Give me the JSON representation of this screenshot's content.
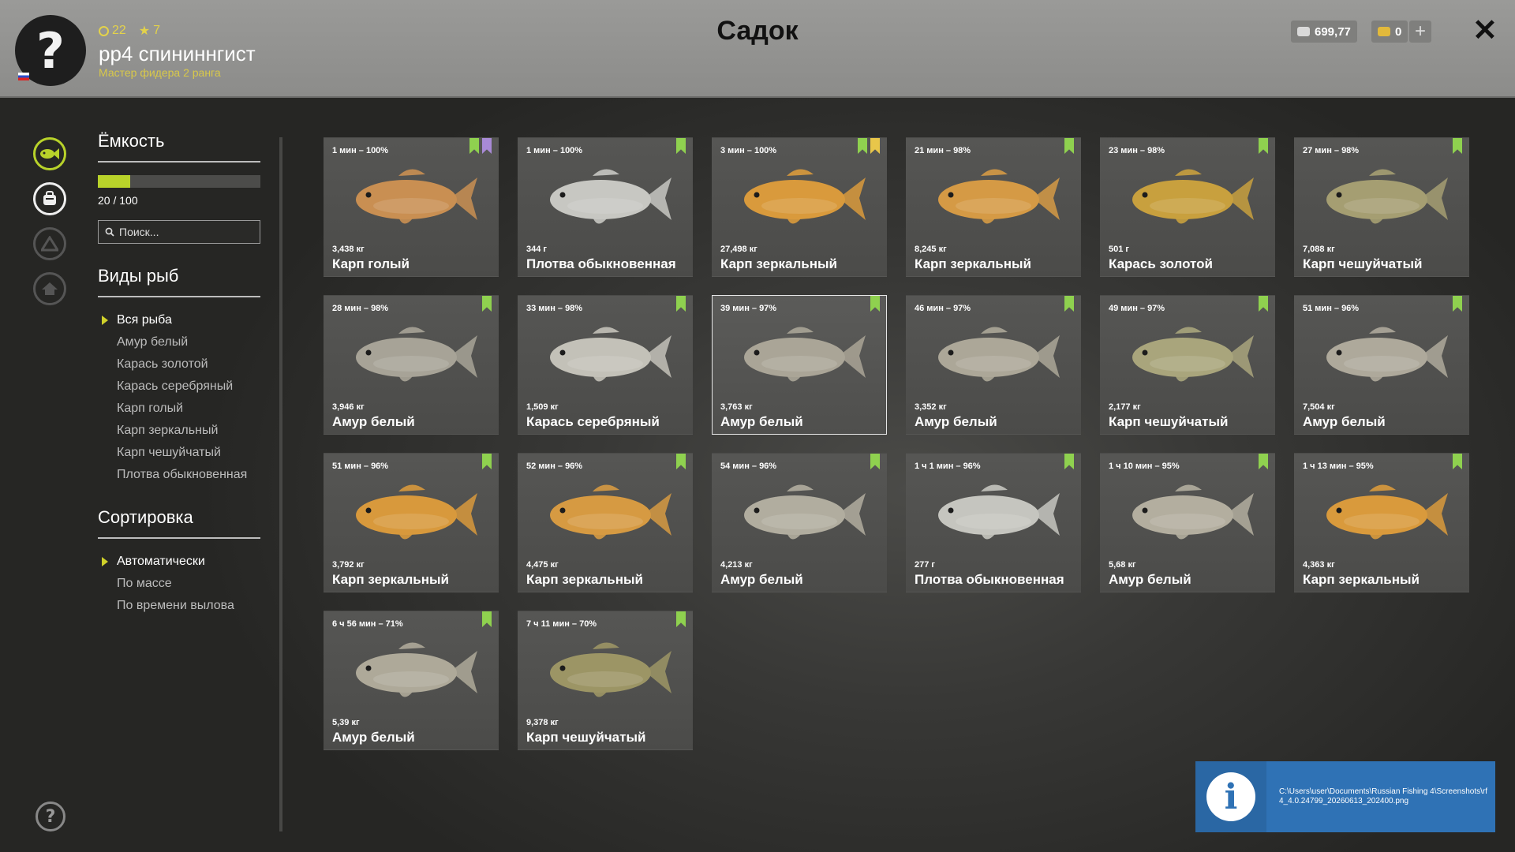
{
  "header": {
    "title": "Садок",
    "player": {
      "avatar_glyph": "?",
      "level": "22",
      "stars": "7",
      "nickname": "рр4 спининнгист",
      "rank": "Мастер фидера 2 ранга"
    },
    "silver": "699,77",
    "gold": "0",
    "add_label": "+",
    "close_label": "✕"
  },
  "colors": {
    "accent": "#b8d22a",
    "bookmark_green": "#8fd14f",
    "bookmark_purple": "#a88ad6",
    "bookmark_gold": "#e8c64a",
    "toast": "#2f72b5"
  },
  "capacity": {
    "title": "Ёмкость",
    "filled_fraction": 0.2,
    "count": "20 / 100"
  },
  "search": {
    "placeholder": "Поиск..."
  },
  "species": {
    "title": "Виды рыб",
    "items": [
      "Вся рыба",
      "Амур белый",
      "Карась золотой",
      "Карась серебряный",
      "Карп голый",
      "Карп зеркальный",
      "Карп чешуйчатый",
      "Плотва обыкновенная"
    ],
    "active": 0
  },
  "sorting": {
    "title": "Сортировка",
    "items": [
      "Автоматически",
      "По массе",
      "По времени вылова"
    ],
    "active": 0
  },
  "help_glyph": "?",
  "fish": [
    {
      "time": "1 мин – 100%",
      "weight": "3,438 кг",
      "name": "Карп голый",
      "color": "#c98f52",
      "marks": [
        "green",
        "purple"
      ]
    },
    {
      "time": "1 мин – 100%",
      "weight": "344 г",
      "name": "Плотва обыкновенная",
      "color": "#c7c7c2",
      "marks": [
        "green"
      ]
    },
    {
      "time": "3 мин – 100%",
      "weight": "27,498 кг",
      "name": "Карп зеркальный",
      "color": "#d99a3c",
      "marks": [
        "green",
        "gold"
      ]
    },
    {
      "time": "21 мин – 98%",
      "weight": "8,245 кг",
      "name": "Карп зеркальный",
      "color": "#d59a45",
      "marks": [
        "green"
      ]
    },
    {
      "time": "23 мин – 98%",
      "weight": "501 г",
      "name": "Карась золотой",
      "color": "#c8a03e",
      "marks": [
        "green"
      ]
    },
    {
      "time": "27 мин – 98%",
      "weight": "7,088 кг",
      "name": "Карп чешуйчатый",
      "color": "#a59e72",
      "marks": [
        "green"
      ]
    },
    {
      "time": "28 мин – 98%",
      "weight": "3,946 кг",
      "name": "Амур белый",
      "color": "#a7a397",
      "marks": [
        "green"
      ]
    },
    {
      "time": "33 мин – 98%",
      "weight": "1,509 кг",
      "name": "Карась серебряный",
      "color": "#c3c1b8",
      "marks": [
        "green"
      ]
    },
    {
      "time": "39 мин – 97%",
      "weight": "3,763 кг",
      "name": "Амур белый",
      "color": "#aaa597",
      "marks": [
        "green"
      ],
      "selected": true
    },
    {
      "time": "46 мин – 97%",
      "weight": "3,352 кг",
      "name": "Амур белый",
      "color": "#aca798",
      "marks": [
        "green"
      ]
    },
    {
      "time": "49 мин – 97%",
      "weight": "2,177 кг",
      "name": "Карп чешуйчатый",
      "color": "#a9a57c",
      "marks": [
        "green"
      ]
    },
    {
      "time": "51 мин – 96%",
      "weight": "7,504 кг",
      "name": "Амур белый",
      "color": "#aea99b",
      "marks": [
        "green"
      ]
    },
    {
      "time": "51 мин – 96%",
      "weight": "3,792 кг",
      "name": "Карп зеркальный",
      "color": "#d8993c",
      "marks": [
        "green"
      ]
    },
    {
      "time": "52 мин – 96%",
      "weight": "4,475 кг",
      "name": "Карп зеркальный",
      "color": "#d69a42",
      "marks": [
        "green"
      ]
    },
    {
      "time": "54 мин – 96%",
      "weight": "4,213 кг",
      "name": "Амур белый",
      "color": "#b1ad9f",
      "marks": [
        "green"
      ]
    },
    {
      "time": "1 ч 1 мин – 96%",
      "weight": "277 г",
      "name": "Плотва обыкновенная",
      "color": "#c5c5bf",
      "marks": [
        "green"
      ]
    },
    {
      "time": "1 ч 10 мин – 95%",
      "weight": "5,68 кг",
      "name": "Амур белый",
      "color": "#b3ae9f",
      "marks": [
        "green"
      ]
    },
    {
      "time": "1 ч 13 мин – 95%",
      "weight": "4,363 кг",
      "name": "Карп зеркальный",
      "color": "#d99a3c",
      "marks": [
        "green"
      ]
    },
    {
      "time": "6 ч 56 мин – 71%",
      "weight": "5,39 кг",
      "name": "Амур белый",
      "color": "#aea999",
      "marks": [
        "green"
      ]
    },
    {
      "time": "7 ч 11 мин – 70%",
      "weight": "9,378 кг",
      "name": "Карп чешуйчатый",
      "color": "#9c9565",
      "marks": [
        "green"
      ]
    }
  ],
  "notification": {
    "icon_glyph": "i",
    "text": "C:\\Users\\user\\Documents\\Russian Fishing 4\\Screenshots\\rf4_4.0.24799_20260613_202400.png"
  }
}
